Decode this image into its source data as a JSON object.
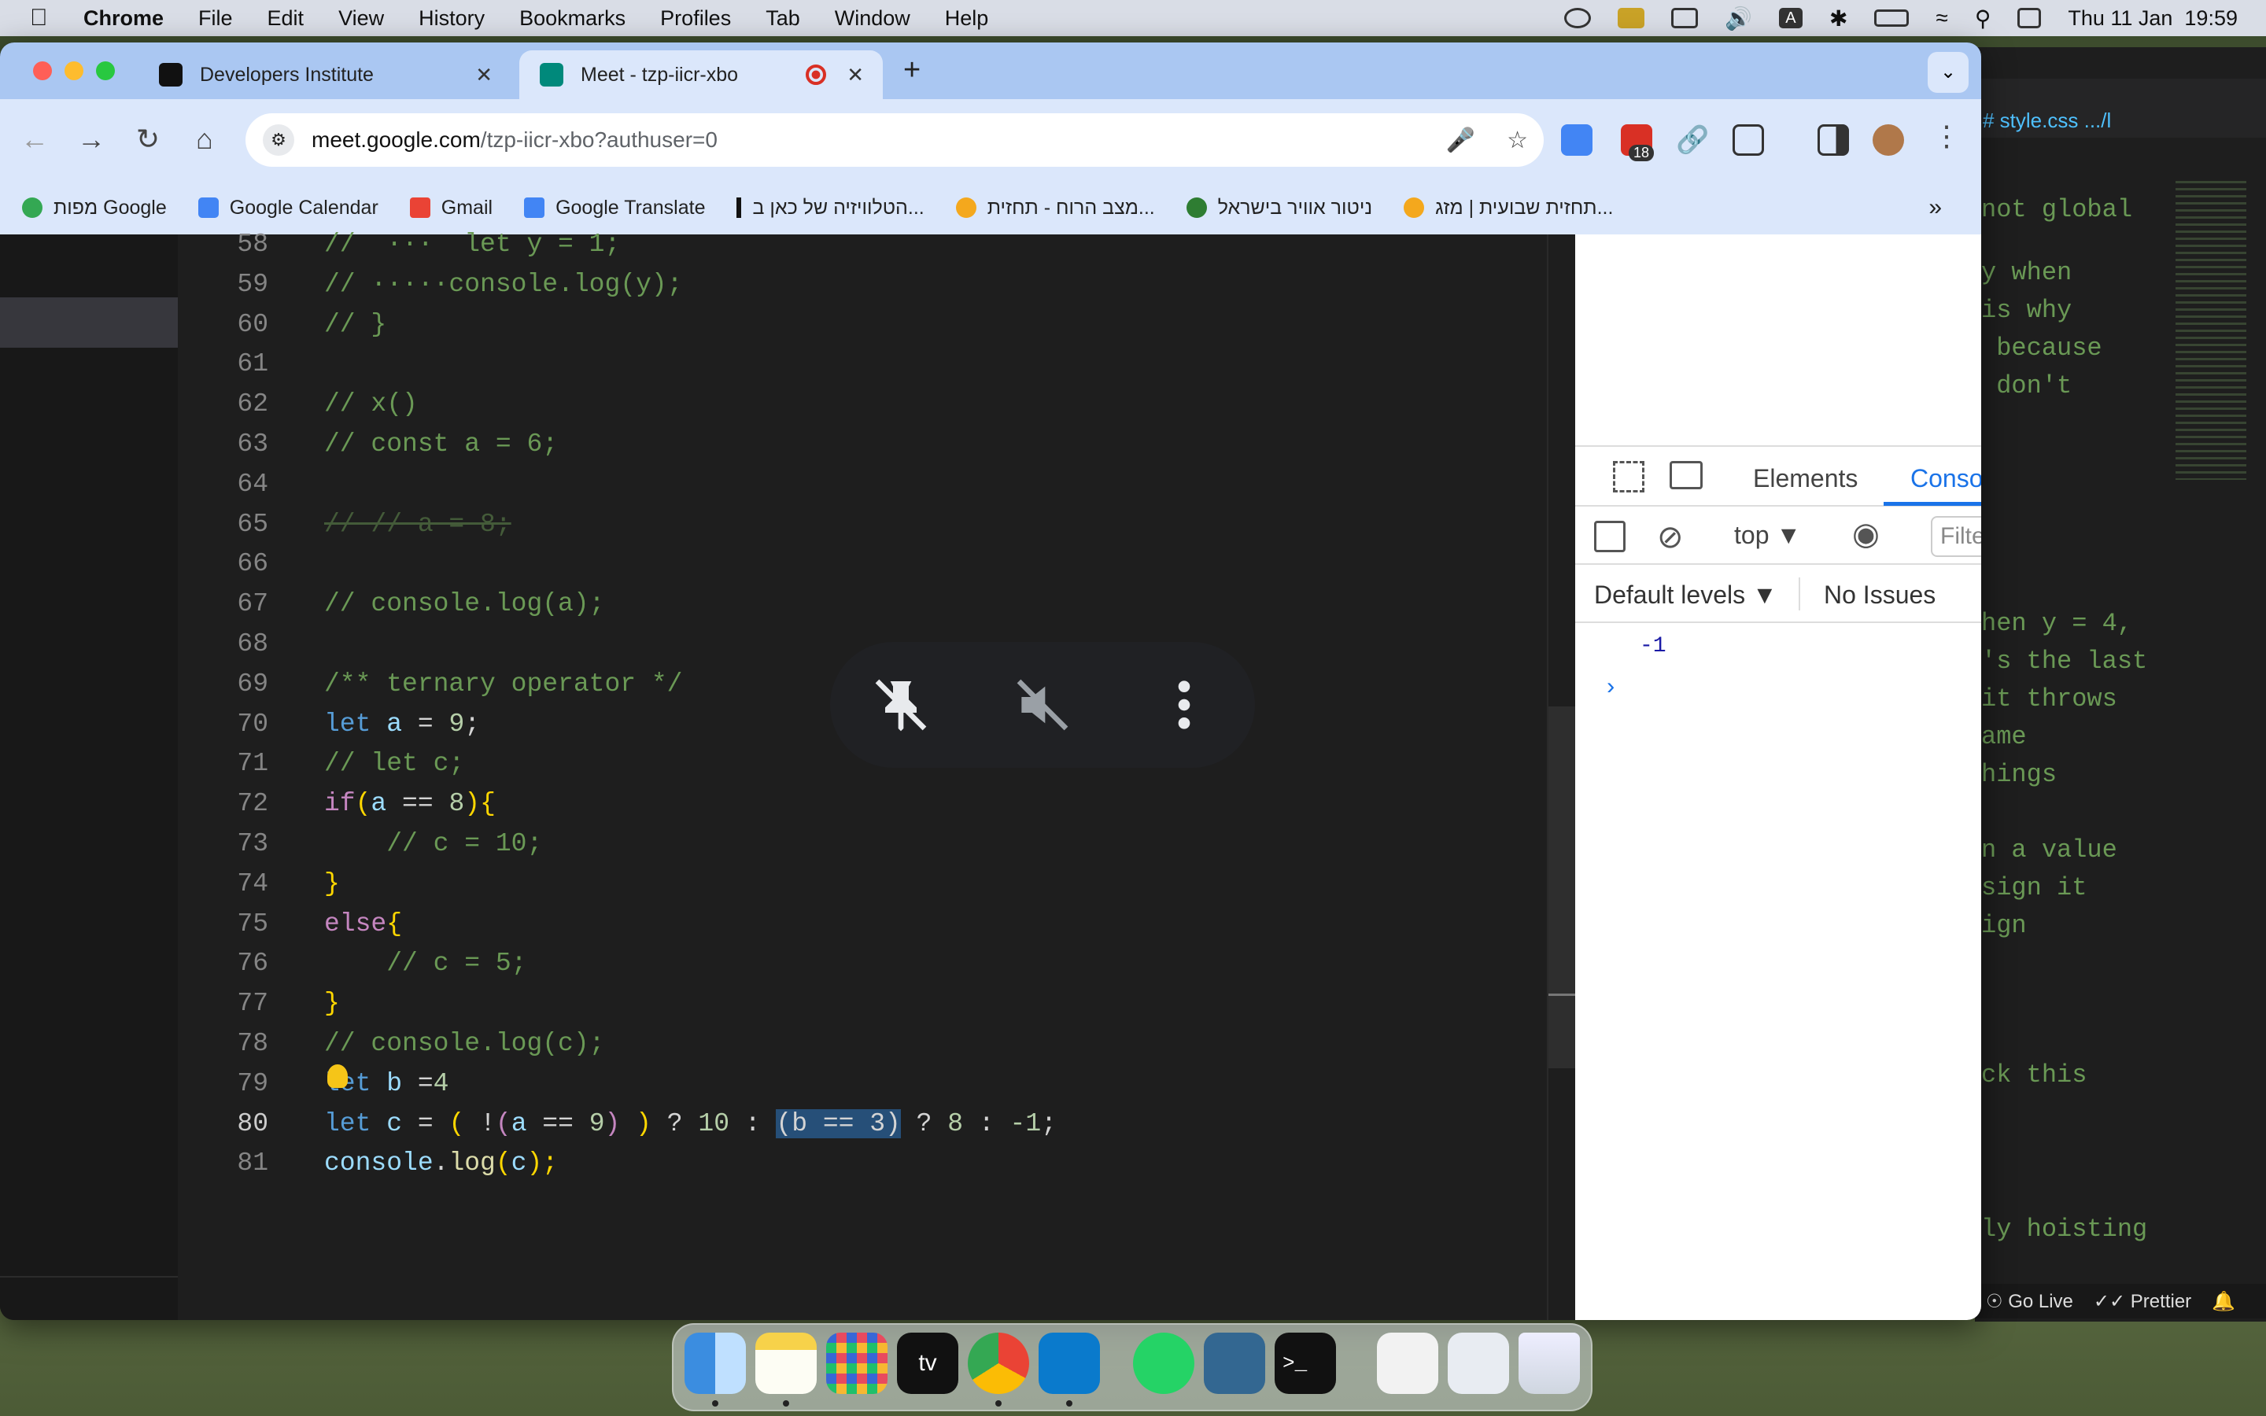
{
  "menubar": {
    "app": "Chrome",
    "menus": [
      "File",
      "Edit",
      "View",
      "History",
      "Bookmarks",
      "Profiles",
      "Tab",
      "Window",
      "Help"
    ],
    "clock": "Thu 11 Jan  19:59"
  },
  "chrome": {
    "tabs": [
      {
        "title": "Developers Institute",
        "active": false
      },
      {
        "title": "Meet - tzp-iicr-xbo",
        "active": true
      }
    ],
    "url_host": "meet.google.com",
    "url_path": "/tzp-iicr-xbo?authuser=0",
    "extension_badge": "18",
    "bookmarks": [
      "מפות Google",
      "Google Calendar",
      "Gmail",
      "Google Translate",
      "הטלוויזיה של כאן ב...",
      "מצב הרוח - תחזית...",
      "ניטור אוויר בישראל",
      "תחזית שבועית | מזג..."
    ]
  },
  "editor": {
    "lines": [
      {
        "n": "58",
        "segments": [
          {
            "t": "//  ···  let y = 1;",
            "c": "cm"
          }
        ]
      },
      {
        "n": "59",
        "segments": [
          {
            "t": "// ·····console.log(y);",
            "c": "cm"
          }
        ]
      },
      {
        "n": "60",
        "segments": [
          {
            "t": "// }",
            "c": "cm"
          }
        ]
      },
      {
        "n": "61",
        "segments": []
      },
      {
        "n": "62",
        "segments": [
          {
            "t": "// x()",
            "c": "cm"
          }
        ]
      },
      {
        "n": "63",
        "segments": [
          {
            "t": "// const a = 6;",
            "c": "cm"
          }
        ]
      },
      {
        "n": "64",
        "segments": []
      },
      {
        "n": "65",
        "segments": [
          {
            "t": "// // a = 8;",
            "c": "strike"
          }
        ]
      },
      {
        "n": "66",
        "segments": []
      },
      {
        "n": "67",
        "segments": [
          {
            "t": "// console.log(a);",
            "c": "cm"
          }
        ]
      },
      {
        "n": "68",
        "segments": []
      },
      {
        "n": "69",
        "segments": [
          {
            "t": "/** ternary operator */",
            "c": "cm"
          }
        ]
      },
      {
        "n": "70",
        "segments": [
          {
            "t": "let ",
            "c": "kw"
          },
          {
            "t": "a",
            "c": "var"
          },
          {
            "t": " = ",
            "c": ""
          },
          {
            "t": "9",
            "c": "num"
          },
          {
            "t": ";",
            "c": ""
          }
        ]
      },
      {
        "n": "71",
        "segments": [
          {
            "t": "// let c;",
            "c": "cm"
          }
        ]
      },
      {
        "n": "72",
        "segments": [
          {
            "t": "if",
            "c": "kw2"
          },
          {
            "t": "(",
            "c": "br"
          },
          {
            "t": "a",
            "c": "var"
          },
          {
            "t": " == ",
            "c": ""
          },
          {
            "t": "8",
            "c": "num"
          },
          {
            "t": "){",
            "c": "br"
          }
        ]
      },
      {
        "n": "73",
        "segments": [
          {
            "t": "    // c = 10;",
            "c": "cm"
          }
        ]
      },
      {
        "n": "74",
        "segments": [
          {
            "t": "}",
            "c": "br"
          }
        ]
      },
      {
        "n": "75",
        "segments": [
          {
            "t": "else",
            "c": "kw2"
          },
          {
            "t": "{",
            "c": "br"
          }
        ]
      },
      {
        "n": "76",
        "segments": [
          {
            "t": "    // c = 5;",
            "c": "cm"
          }
        ]
      },
      {
        "n": "77",
        "segments": [
          {
            "t": "}",
            "c": "br"
          }
        ]
      },
      {
        "n": "78",
        "segments": [
          {
            "t": "// console.log(c);",
            "c": "cm"
          }
        ]
      },
      {
        "n": "79",
        "segments": [
          {
            "t": "let ",
            "c": "kw"
          },
          {
            "t": "b",
            "c": "var"
          },
          {
            "t": " =",
            "c": ""
          },
          {
            "t": "4",
            "c": "num"
          }
        ]
      },
      {
        "n": "80",
        "current": true,
        "segments": [
          {
            "t": "let ",
            "c": "kw"
          },
          {
            "t": "c",
            "c": "var"
          },
          {
            "t": " = ",
            "c": ""
          },
          {
            "t": "(",
            "c": "br"
          },
          {
            "t": " !",
            "c": ""
          },
          {
            "t": "(",
            "c": "kw2"
          },
          {
            "t": "a",
            "c": "var"
          },
          {
            "t": " == ",
            "c": ""
          },
          {
            "t": "9",
            "c": "num"
          },
          {
            "t": ")",
            "c": "kw2"
          },
          {
            "t": " ",
            "c": ""
          },
          {
            "t": ")",
            "c": "br"
          },
          {
            "t": " ? ",
            "c": ""
          },
          {
            "t": "10",
            "c": "num"
          },
          {
            "t": " : ",
            "c": ""
          },
          {
            "t": "(b == 3)",
            "c": "selbox"
          },
          {
            "t": " ? ",
            "c": ""
          },
          {
            "t": "8",
            "c": "num"
          },
          {
            "t": " : ",
            "c": ""
          },
          {
            "t": "-1",
            "c": "num"
          },
          {
            "t": ";",
            "c": ""
          }
        ]
      },
      {
        "n": "81",
        "segments": [
          {
            "t": "console",
            "c": "var"
          },
          {
            "t": ".",
            "c": ""
          },
          {
            "t": "log",
            "c": "fn"
          },
          {
            "t": "(",
            "c": "br"
          },
          {
            "t": "c",
            "c": "var"
          },
          {
            "t": ");",
            "c": "br"
          }
        ]
      }
    ]
  },
  "devtools": {
    "tabs": [
      "Elements",
      "Conso"
    ],
    "context": "top",
    "filter_placeholder": "Filte",
    "levels": "Default levels",
    "issues": "No Issues",
    "output": [
      "-1"
    ]
  },
  "vscode": {
    "tab": "# style.css .../l",
    "comment_lines": [
      {
        "t": "not global"
      },
      {
        "t": "y when"
      },
      {
        "t": "is why"
      },
      {
        "t": " because"
      },
      {
        "t": " don't"
      },
      {
        "t": "hen y = 4,"
      },
      {
        "t": "'s the last"
      },
      {
        "t": "it throws"
      },
      {
        "t": "ame"
      },
      {
        "t": "hings"
      },
      {
        "t": "n a value"
      },
      {
        "t": "sign it"
      },
      {
        "t": "ign"
      },
      {
        "t": "ck this"
      },
      {
        "t": "ly hoisting"
      }
    ],
    "status_golive": "Go Live",
    "status_prettier": "Prettier"
  }
}
